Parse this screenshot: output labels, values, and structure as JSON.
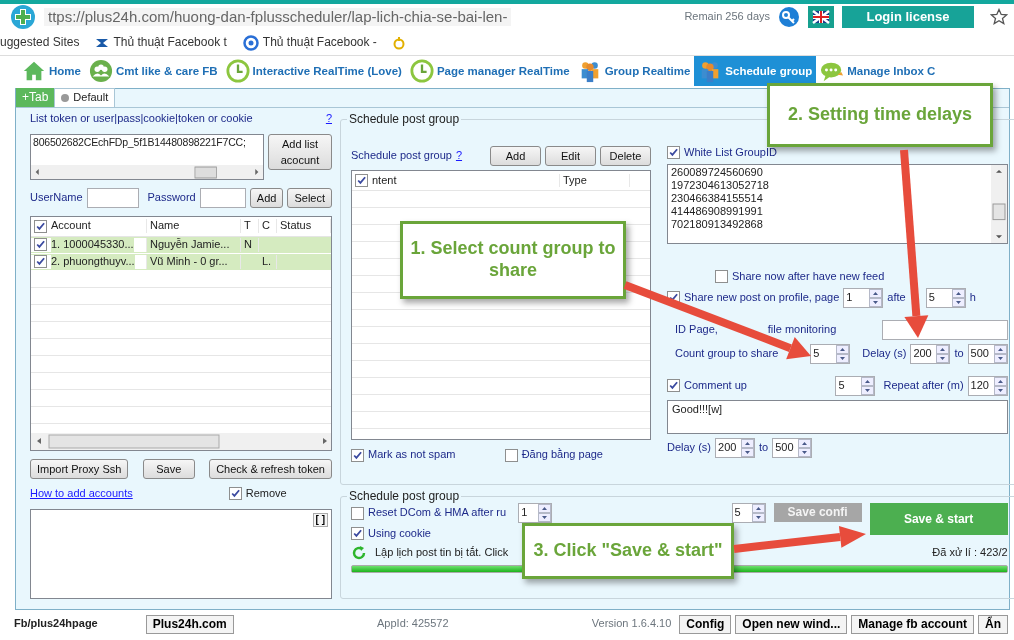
{
  "browser": {
    "url": "ttps://plus24h.com/huong-dan-fplusscheduler/lap-lich-chia-se-bai-len-",
    "remain": "Remain 256 days",
    "login_button": "Login license"
  },
  "bookmarks": [
    {
      "label": "uggested Sites",
      "kind": "plain"
    },
    {
      "label": "Thủ thuật Facebook t",
      "kind": "ribbon"
    },
    {
      "label": "Thủ thuật Facebook -",
      "kind": "ring"
    },
    {
      "kind": "coin"
    }
  ],
  "nav_tabs": [
    {
      "label": "Home",
      "kind": "house",
      "selected": false
    },
    {
      "label": "Cmt like & care FB",
      "kind": "people",
      "selected": false
    },
    {
      "label": "Interactive RealTime (Love)",
      "kind": "clock",
      "selected": false
    },
    {
      "label": "Page manager RealTime",
      "kind": "clock",
      "selected": false
    },
    {
      "label": "Group Realtime",
      "kind": "group",
      "selected": false
    },
    {
      "label": "Schedule group",
      "kind": "group",
      "selected": true
    },
    {
      "label": "Manage Inbox C",
      "kind": "chat",
      "selected": false
    }
  ],
  "add_tab_button": "+Tab",
  "doc_tabs": [
    {
      "label": "Default",
      "selected": true
    }
  ],
  "accounts_panel": {
    "list_label": "List token or user|pass|cookie|token or cookie",
    "help_link": "?",
    "token_text": "806502682CEchFDp_5f1B14480898221F7CC;",
    "add_list_button": "Add list acocunt",
    "username_label": "UserName",
    "password_label": "Password",
    "add_button": "Add",
    "select_button": "Select",
    "table": {
      "select_all_checked": true,
      "columns": [
        "Account",
        "Name",
        "T",
        "C",
        "Status"
      ],
      "rows": [
        {
          "checked": true,
          "cells": [
            "1. 1000045330...",
            "Nguyễn Jamie...",
            "N",
            "",
            ""
          ]
        },
        {
          "checked": true,
          "cells": [
            "2. phuongthuyv...",
            "Vũ Minh - 0 gr...",
            "",
            "L.",
            ""
          ]
        }
      ]
    },
    "import_button": "Import Proxy Ssh",
    "save_button": "Save",
    "check_button": "Check & refresh token",
    "how_link": "How to add accounts",
    "remove": {
      "label": "Remove",
      "checked": true
    },
    "log_button": "[ ]"
  },
  "schedule_group": {
    "legend": "Schedule post group",
    "label": "Schedule post group",
    "help_link": "?",
    "buttons": [
      "Add",
      "Edit",
      "Delete"
    ],
    "table": {
      "select_all_checked": true,
      "columns": [
        "ntent",
        "Type"
      ]
    },
    "mark_not_spam": {
      "label": "Mark as not spam",
      "checked": true
    },
    "post_as_page": {
      "label": "Đăng bằng page",
      "checked": false
    },
    "whitelist": {
      "label": "White List GroupID",
      "checked": true,
      "ids": [
        "260089724560690",
        "1972304613052718",
        "230466384155514",
        "414486908991991",
        "702180913492868"
      ]
    },
    "share_now": {
      "label": "Share now after have new feed",
      "checked": false
    },
    "share_new": {
      "label": "Share new post on profile, page",
      "checked": true,
      "value": "1",
      "after_label": "afte",
      "after_value": "5",
      "unit": "h"
    },
    "id_page_label": "ID Page,",
    "id_page_label_rest": "file monitoring",
    "count_label": "Count group to share",
    "count_value": "5",
    "delay_label": "Delay (s)",
    "delay_from": "200",
    "to_label": "to",
    "delay_to": "500",
    "comment_up": {
      "label": "Comment up",
      "checked": true,
      "value": "5",
      "repeat_label": "Repeat after (m)",
      "repeat_value": "120",
      "text": "Good!!![w]",
      "delay_label": "Delay (s)",
      "delay_from": "200",
      "to_label": "to",
      "delay_to": "500"
    }
  },
  "run_group": {
    "legend": "Schedule post group",
    "reset": {
      "label": "Reset DCom & HMA after ru",
      "checked": false
    },
    "reset_value": "1",
    "delay_value": "5",
    "cookie": {
      "label": "Using cookie",
      "checked": true
    },
    "save_config_button": "Save confi",
    "save_start_button": "Save & start",
    "status_text": "Lập lịch post tin bị tắt. Click",
    "processed": "Đã xử lí : 423/2",
    "level": 1
  },
  "status_bar": {
    "page": "Fb/plus24hpage",
    "site_button": "Plus24h.com",
    "app_id": "AppId: 425572",
    "version": "Version 1.6.4.10",
    "buttons": [
      "Config",
      "Open new wind...",
      "Manage fb account",
      "Ẩn"
    ]
  },
  "callouts": [
    {
      "text": "1. Select count group to share"
    },
    {
      "text": "2. Setting time delays"
    },
    {
      "text": "3. Click \"Save & start\""
    }
  ]
}
